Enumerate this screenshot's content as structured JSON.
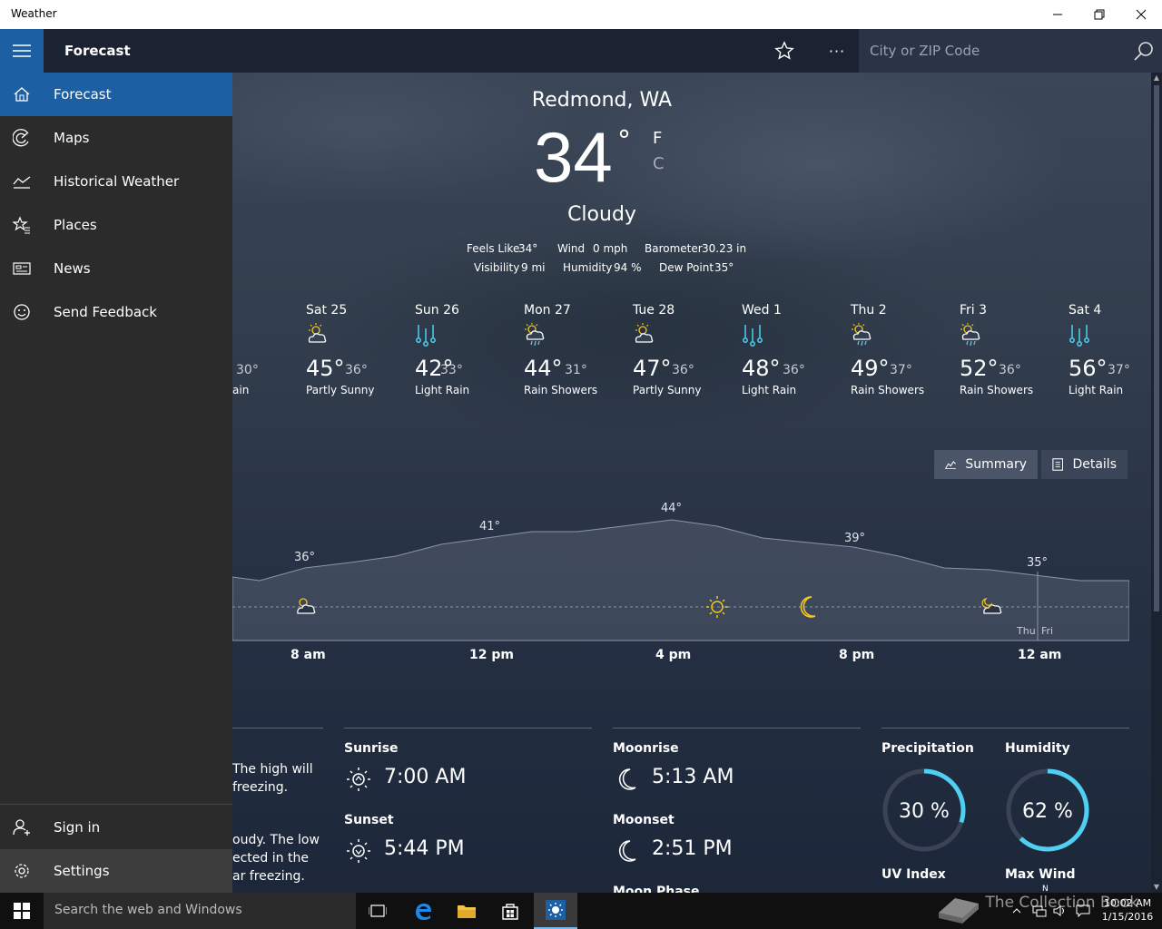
{
  "window": {
    "title": "Weather"
  },
  "appbar": {
    "title": "Forecast",
    "search_placeholder": "City or ZIP Code"
  },
  "nav": {
    "items": [
      {
        "label": "Forecast",
        "icon": "home-icon"
      },
      {
        "label": "Maps",
        "icon": "radar-icon"
      },
      {
        "label": "Historical Weather",
        "icon": "chart-icon"
      },
      {
        "label": "Places",
        "icon": "star-list-icon"
      },
      {
        "label": "News",
        "icon": "newspaper-icon"
      },
      {
        "label": "Send Feedback",
        "icon": "smiley-icon"
      }
    ],
    "bottom": [
      {
        "label": "Sign in",
        "icon": "person-add-icon"
      },
      {
        "label": "Settings",
        "icon": "gear-icon"
      }
    ]
  },
  "current": {
    "location": "Redmond, WA",
    "temp": "34",
    "deg": "°",
    "unit_f": "F",
    "unit_c": "C",
    "condition": "Cloudy",
    "feels_label": "Feels Like",
    "feels": "34°",
    "wind_label": "Wind",
    "wind": "0 mph",
    "baro_label": "Barometer",
    "baro": "30.23 in",
    "vis_label": "Visibility",
    "vis": "9 mi",
    "hum_label": "Humidity",
    "hum": "94 %",
    "dew_label": "Dew Point",
    "dew": "35°"
  },
  "partial_day": {
    "lo": "30°",
    "cond": "ain"
  },
  "days": [
    {
      "name": "Sat 25",
      "hi": "45°",
      "lo": "36°",
      "cond": "Partly Sunny",
      "icon": "partly-sunny-icon"
    },
    {
      "name": "Sun 26",
      "hi": "42°",
      "lo": "33°",
      "cond": "Light Rain",
      "icon": "light-rain-icon"
    },
    {
      "name": "Mon 27",
      "hi": "44°",
      "lo": "31°",
      "cond": "Rain Showers",
      "icon": "rain-showers-icon"
    },
    {
      "name": "Tue 28",
      "hi": "47°",
      "lo": "36°",
      "cond": "Partly Sunny",
      "icon": "partly-sunny-icon"
    },
    {
      "name": "Wed 1",
      "hi": "48°",
      "lo": "36°",
      "cond": "Light Rain",
      "icon": "light-rain-icon"
    },
    {
      "name": "Thu 2",
      "hi": "49°",
      "lo": "37°",
      "cond": "Rain Showers",
      "icon": "rain-showers-icon"
    },
    {
      "name": "Fri 3",
      "hi": "52°",
      "lo": "36°",
      "cond": "Rain Showers",
      "icon": "rain-showers-icon"
    },
    {
      "name": "Sat 4",
      "hi": "56°",
      "lo": "37°",
      "cond": "Light Rain",
      "icon": "light-rain-icon"
    }
  ],
  "toggle": {
    "summary": "Summary",
    "details": "Details"
  },
  "hourly": {
    "temp_labels": [
      "36°",
      "41°",
      "44°",
      "39°",
      "35°"
    ],
    "time_labels": [
      "8 am",
      "12 pm",
      "4 pm",
      "8 pm",
      "12 am"
    ],
    "day_boundary": [
      "Thu",
      "Fri"
    ]
  },
  "summary_text": {
    "line1": "The high will",
    "line2": "freezing.",
    "line3": "oudy. The low",
    "line4": "ected in the",
    "line5": "ar freezing."
  },
  "sun": {
    "sunrise_label": "Sunrise",
    "sunrise": "7:00 AM",
    "sunset_label": "Sunset",
    "sunset": "5:44 PM"
  },
  "moon": {
    "moonrise_label": "Moonrise",
    "moonrise": "5:13 AM",
    "moonset_label": "Moonset",
    "moonset": "2:51 PM",
    "phase_label": "Moon Phase"
  },
  "stats": {
    "precip_label": "Precipitation",
    "precip": "30 %",
    "precip_frac": 0.3,
    "humidity_label": "Humidity",
    "humidity": "62 %",
    "humidity_frac": 0.62,
    "uv_label": "UV Index",
    "wind_label": "Max Wind",
    "wind_dir": "N"
  },
  "taskbar": {
    "search": "Search the web and Windows",
    "time": "10:02 AM",
    "date": "1/15/2016",
    "watermark": "The Collection Book"
  },
  "colors": {
    "accent": "#1d5fa3",
    "ring": "#4fd0f2",
    "sun": "#f3c623"
  }
}
